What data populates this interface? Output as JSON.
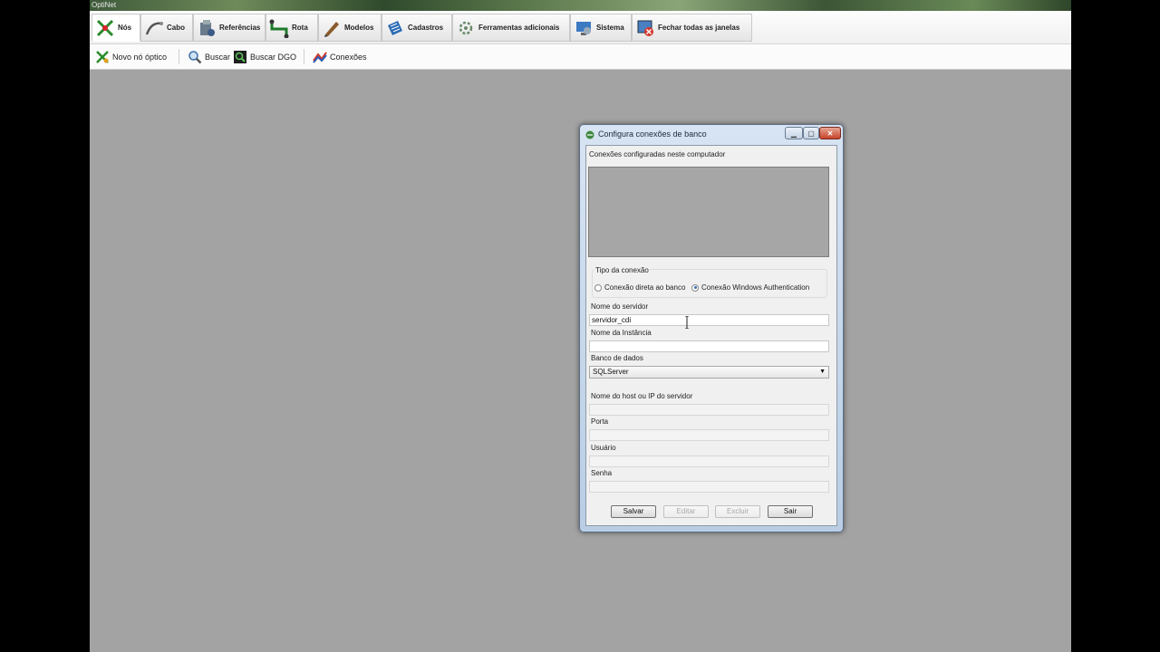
{
  "window": {
    "app_title": "OptiNet"
  },
  "toolbar": {
    "tabs": [
      {
        "label": "Nós",
        "icon": "node-icon",
        "active": true
      },
      {
        "label": "Cabo",
        "icon": "cable-icon"
      },
      {
        "label": "Referências",
        "icon": "references-icon"
      },
      {
        "label": "Rota",
        "icon": "route-icon"
      },
      {
        "label": "Modelos",
        "icon": "models-icon"
      },
      {
        "label": "Cadastros",
        "icon": "records-icon"
      },
      {
        "label": "Ferramentas adicionais",
        "icon": "tools-icon"
      },
      {
        "label": "Sistema",
        "icon": "system-icon"
      },
      {
        "label": "Fechar todas as janelas",
        "icon": "close-windows-icon"
      }
    ]
  },
  "subtoolbar": {
    "new_node": "Novo nó óptico",
    "search": "Buscar",
    "search_dgo": "Buscar DGO",
    "connections": "Conexões"
  },
  "dialog": {
    "title": "Configura conexões de banco",
    "list_label": "Conexões configuradas neste computador",
    "group_label": "Tipo da conexão",
    "radio_direct": "Conexão direta ao banco",
    "radio_windows": "Conexão Windows Authentication",
    "server_label": "Nome do servidor",
    "server_value": "servidor_cdi",
    "instance_label": "Nome da Instância",
    "instance_value": "",
    "db_label": "Banco de dados",
    "db_value": "SQLServer",
    "host_label": "Nome do host ou IP do servidor",
    "port_label": "Porta",
    "user_label": "Usuário",
    "password_label": "Senha",
    "btn_save": "Salvar",
    "btn_edit": "Editar",
    "btn_delete": "Excluir",
    "btn_exit": "Sair"
  },
  "colors": {
    "workspace": "#a3a3a3",
    "accent": "#3a6fb0"
  }
}
